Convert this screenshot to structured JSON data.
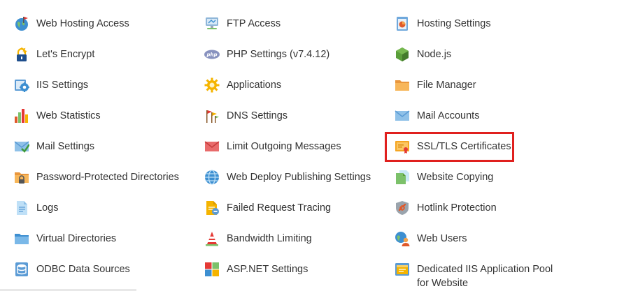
{
  "tools": [
    {
      "label": "Web Hosting Access",
      "icon": "globe-flag-icon"
    },
    {
      "label": "FTP Access",
      "icon": "ftp-monitor-icon"
    },
    {
      "label": "Hosting Settings",
      "icon": "hosting-settings-icon"
    },
    {
      "label": "Let's Encrypt",
      "icon": "lock-icon"
    },
    {
      "label": "PHP Settings (v7.4.12)",
      "icon": "php-icon"
    },
    {
      "label": "Node.js",
      "icon": "nodejs-icon"
    },
    {
      "label": "IIS Settings",
      "icon": "iis-settings-icon"
    },
    {
      "label": "Applications",
      "icon": "gear-icon"
    },
    {
      "label": "File Manager",
      "icon": "folder-icon"
    },
    {
      "label": "Web Statistics",
      "icon": "bar-chart-icon"
    },
    {
      "label": "DNS Settings",
      "icon": "dns-flags-icon"
    },
    {
      "label": "Mail Accounts",
      "icon": "envelope-icon"
    },
    {
      "label": "Mail Settings",
      "icon": "mail-check-icon"
    },
    {
      "label": "Limit Outgoing Messages",
      "icon": "envelope-red-icon"
    },
    {
      "label": "SSL/TLS Certificates",
      "icon": "certificate-icon"
    },
    {
      "label": "Password-Protected Directories",
      "icon": "locked-folder-icon"
    },
    {
      "label": "Web Deploy Publishing Settings",
      "icon": "globe-icon"
    },
    {
      "label": "Website Copying",
      "icon": "copy-pages-icon"
    },
    {
      "label": "Logs",
      "icon": "log-document-icon"
    },
    {
      "label": "Failed Request Tracing",
      "icon": "failed-request-icon"
    },
    {
      "label": "Hotlink Protection",
      "icon": "hotlink-icon"
    },
    {
      "label": "Virtual Directories",
      "icon": "virtual-folder-icon"
    },
    {
      "label": "Bandwidth Limiting",
      "icon": "cone-icon"
    },
    {
      "label": "Web Users",
      "icon": "web-user-icon"
    },
    {
      "label": "ODBC Data Sources",
      "icon": "database-icon"
    },
    {
      "label": "ASP.NET Settings",
      "icon": "aspnet-icon"
    },
    {
      "label": "Dedicated IIS Application Pool for Website",
      "icon": "app-pool-icon"
    }
  ],
  "colors": {
    "highlight": "#e0201e",
    "text": "#333333"
  }
}
